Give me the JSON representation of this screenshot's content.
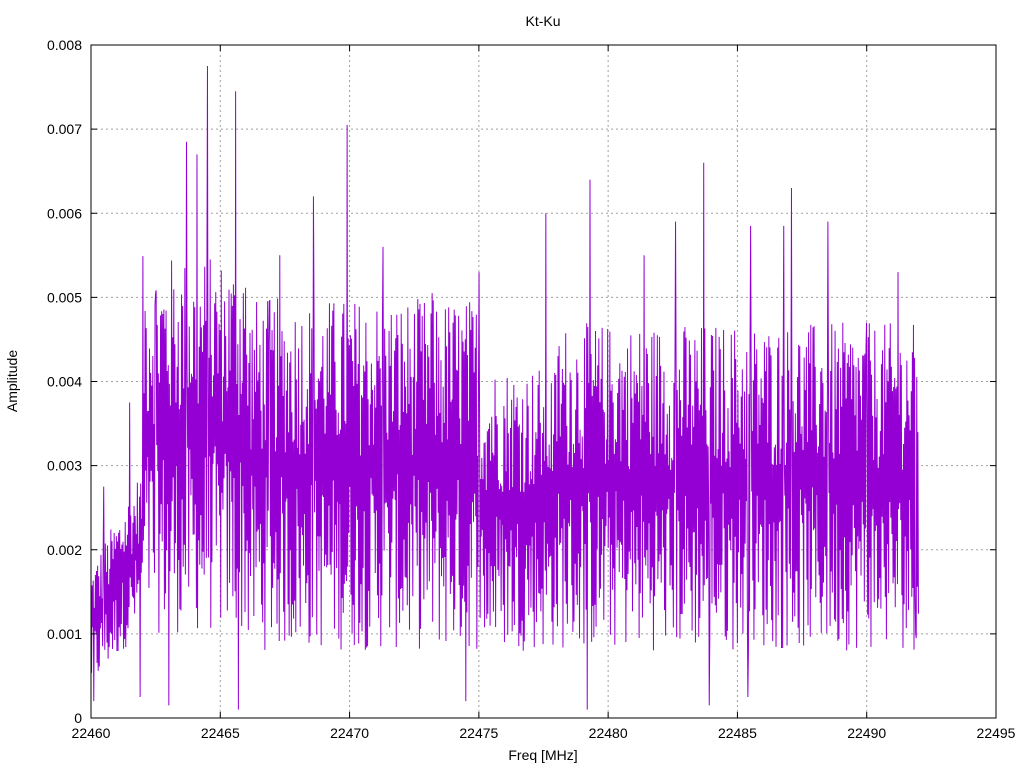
{
  "chart_data": {
    "type": "line",
    "title": "Kt-Ku",
    "xlabel": "Freq [MHz]",
    "ylabel": "Amplitude",
    "xlim": [
      22460,
      22495
    ],
    "ylim": [
      0,
      0.008
    ],
    "x_ticks": [
      "22460",
      "22465",
      "22470",
      "22475",
      "22480",
      "22485",
      "22490",
      "22495"
    ],
    "y_ticks": [
      "0",
      "0.001",
      "0.002",
      "0.003",
      "0.004",
      "0.005",
      "0.006",
      "0.007",
      "0.008"
    ],
    "grid": true,
    "legend": "none",
    "series": [
      {
        "color": "#9400d3",
        "x_start": 22460,
        "x_end": 22492,
        "points": 1500,
        "peaks": [
          {
            "x": 22464.5,
            "y": 0.00775
          },
          {
            "x": 22465.6,
            "y": 0.00745
          },
          {
            "x": 22469.9,
            "y": 0.00705
          },
          {
            "x": 22463.7,
            "y": 0.00685
          },
          {
            "x": 22464.1,
            "y": 0.0067
          },
          {
            "x": 22483.7,
            "y": 0.0066
          },
          {
            "x": 22479.3,
            "y": 0.0064
          },
          {
            "x": 22487.1,
            "y": 0.0063
          },
          {
            "x": 22468.6,
            "y": 0.0062
          },
          {
            "x": 22477.6,
            "y": 0.006
          },
          {
            "x": 22488.5,
            "y": 0.0059
          },
          {
            "x": 22486.8,
            "y": 0.00585
          },
          {
            "x": 22485.5,
            "y": 0.00585
          },
          {
            "x": 22471.3,
            "y": 0.0056
          },
          {
            "x": 22467.3,
            "y": 0.0055
          },
          {
            "x": 22462.5,
            "y": 0.00505
          },
          {
            "x": 22491.2,
            "y": 0.0053
          },
          {
            "x": 22465.9,
            "y": 0.00505
          },
          {
            "x": 22466.9,
            "y": 0.00495
          },
          {
            "x": 22473.2,
            "y": 0.00505
          },
          {
            "x": 22475.0,
            "y": 0.0053
          },
          {
            "x": 22481.4,
            "y": 0.0055
          },
          {
            "x": 22482.6,
            "y": 0.0059
          },
          {
            "x": 22490.0,
            "y": 0.0047
          },
          {
            "x": 22461.5,
            "y": 0.00375
          },
          {
            "x": 22460.5,
            "y": 0.00275
          }
        ],
        "dips": [
          {
            "x": 22465.7,
            "y": 0.0001
          },
          {
            "x": 22463.0,
            "y": 0.00015
          },
          {
            "x": 22479.2,
            "y": 0.0001
          },
          {
            "x": 22483.9,
            "y": 0.00015
          },
          {
            "x": 22485.4,
            "y": 0.00025
          },
          {
            "x": 22474.5,
            "y": 0.0002
          },
          {
            "x": 22461.9,
            "y": 0.00025
          },
          {
            "x": 22460.1,
            "y": 0.0002
          },
          {
            "x": 22491.9,
            "y": 0.001
          }
        ]
      }
    ]
  }
}
